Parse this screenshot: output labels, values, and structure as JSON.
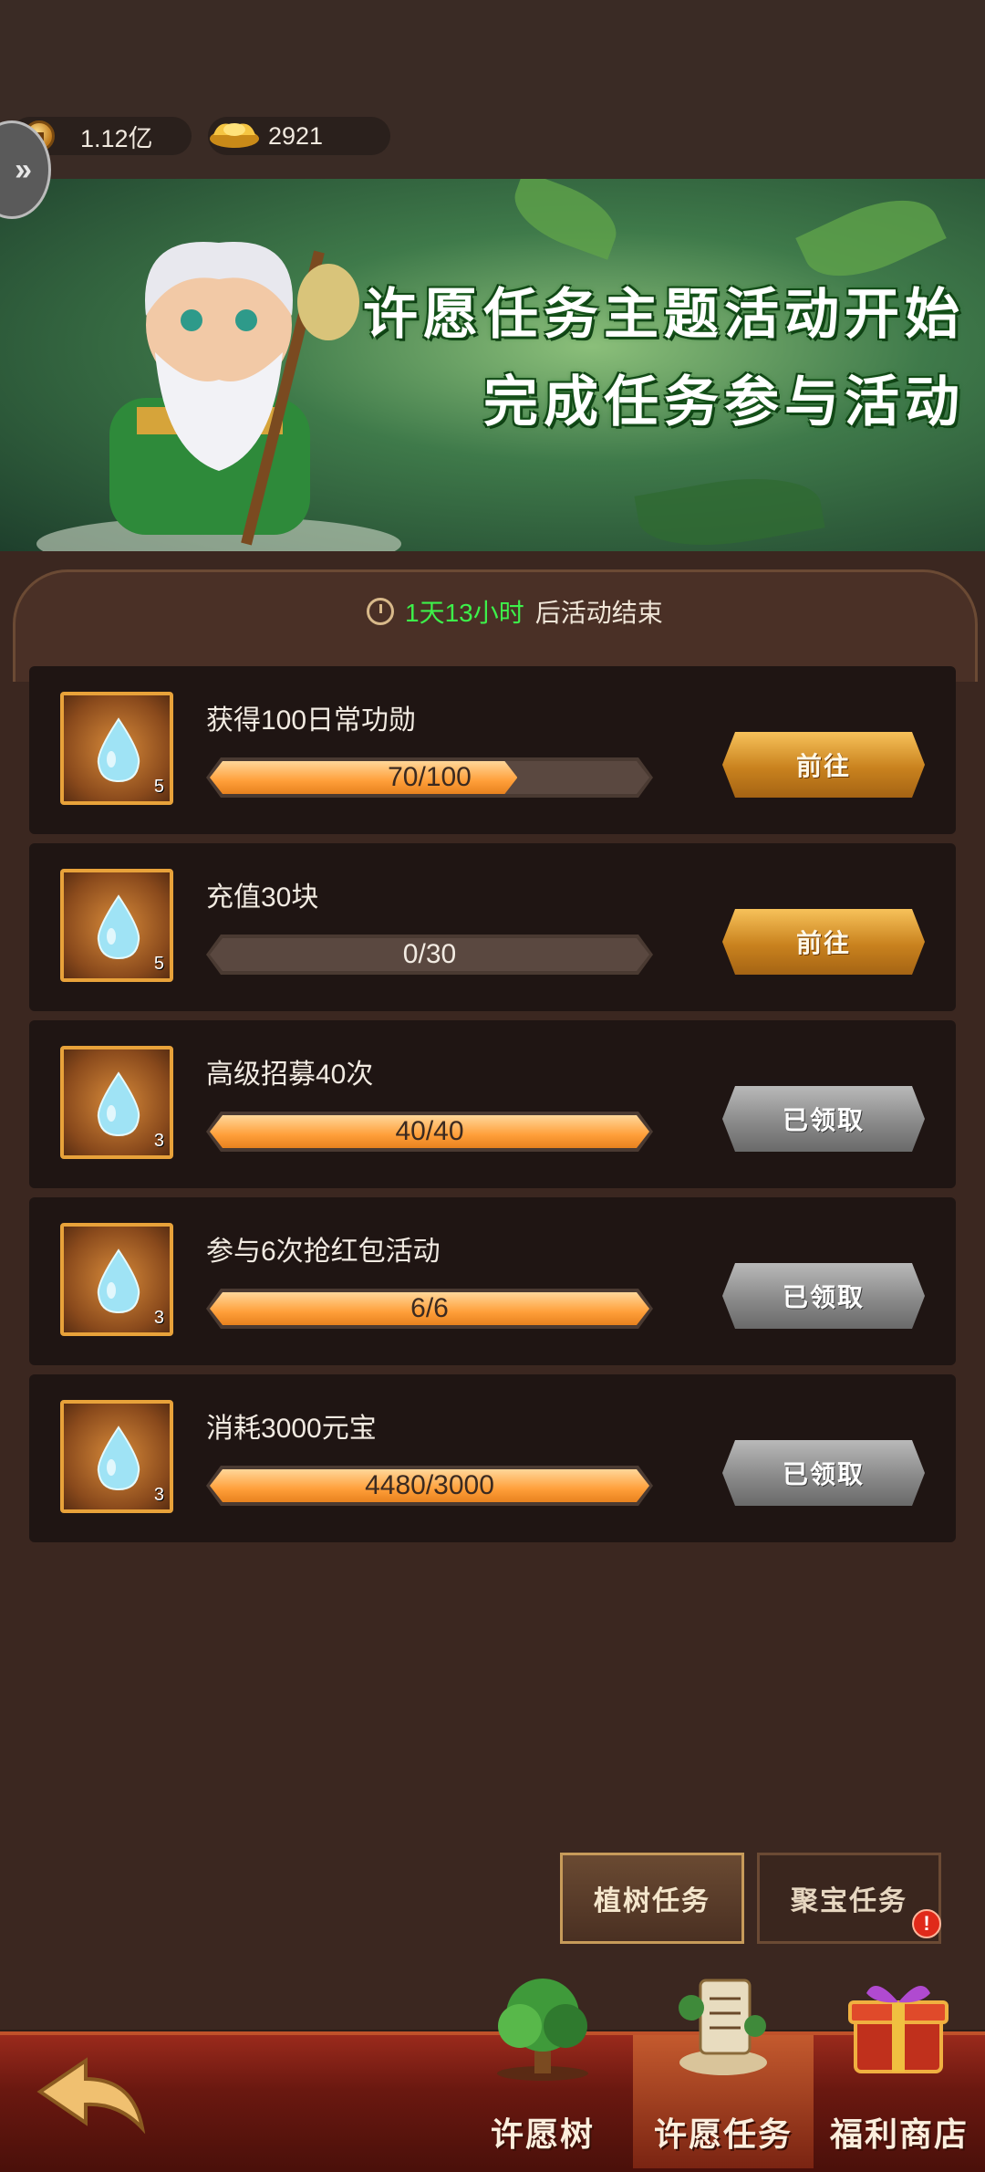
{
  "currency": {
    "coins": "1.12亿",
    "ingots": "2921"
  },
  "banner": {
    "line1": "许愿任务主题活动开始",
    "line2": "完成任务参与活动"
  },
  "timer": {
    "remaining": "1天13小时",
    "suffix": "后活动结束"
  },
  "tasks": [
    {
      "name": "获得100日常功勋",
      "progress_text": "70/100",
      "progress": 0.7,
      "reward_qty": "5",
      "button": "前往",
      "status": "go"
    },
    {
      "name": "充值30块",
      "progress_text": "0/30",
      "progress": 0.0,
      "reward_qty": "5",
      "button": "前往",
      "status": "go"
    },
    {
      "name": "高级招募40次",
      "progress_text": "40/40",
      "progress": 1.0,
      "reward_qty": "3",
      "button": "已领取",
      "status": "done"
    },
    {
      "name": "参与6次抢红包活动",
      "progress_text": "6/6",
      "progress": 1.0,
      "reward_qty": "3",
      "button": "已领取",
      "status": "done"
    },
    {
      "name": "消耗3000元宝",
      "progress_text": "4480/3000",
      "progress": 1.0,
      "reward_qty": "3",
      "button": "已领取",
      "status": "done"
    }
  ],
  "subtabs": [
    {
      "label": "植树任务",
      "active": true
    },
    {
      "label": "聚宝任务",
      "active": false,
      "alert": "!"
    }
  ],
  "nav": [
    {
      "label": "许愿树"
    },
    {
      "label": "许愿任务",
      "active": true
    },
    {
      "label": "福利商店"
    }
  ],
  "colors": {
    "accent_green": "#3df04a",
    "button_gold": "#c9821e",
    "progress_orange": "#ff9f3a"
  }
}
